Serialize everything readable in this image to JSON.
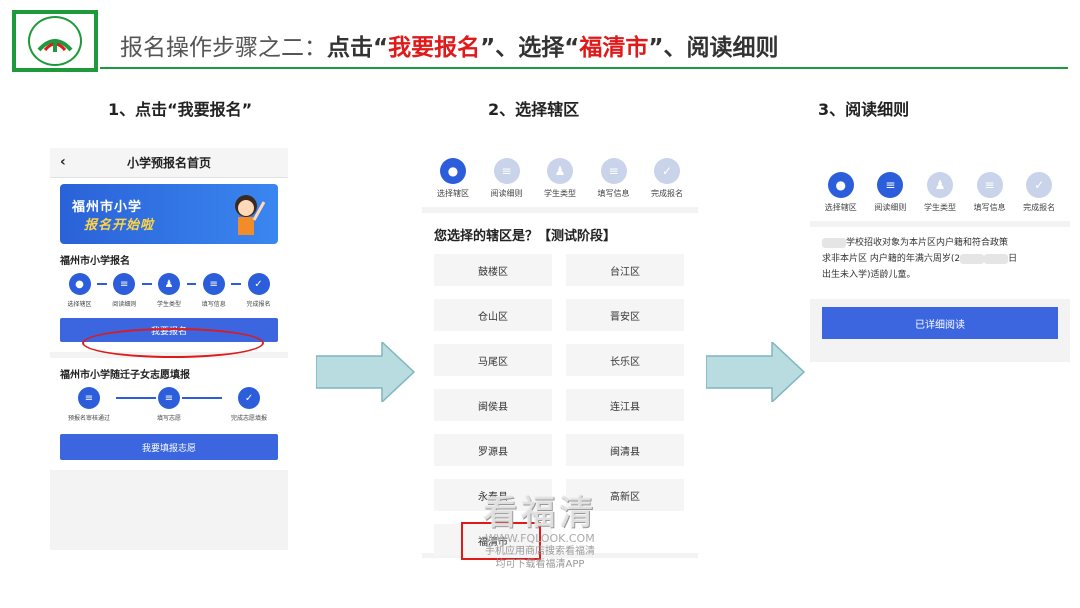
{
  "header": {
    "title_prefix": "报名操作步骤之二：",
    "title_click": "点击",
    "title_q1": "“",
    "title_hl1": "我要报名",
    "title_q2": "”",
    "title_sep1": "、选择",
    "title_q3": "“",
    "title_hl2": "福清市",
    "title_q4": "”",
    "title_sep2": "、阅读细则",
    "accent_color": "#e0191a",
    "brand_color": "#1e9a3c"
  },
  "steps": {
    "s1": "1、点击“我要报名”",
    "s2": "2、选择辖区",
    "s3": "3、阅读细则"
  },
  "phone1": {
    "header_title": "小学预报名首页",
    "back_icon": "chevron-left-icon",
    "banner_line1": "福州市小学",
    "banner_line2": "报名开始啦",
    "section1_title": "福州市小学报名",
    "flow1": [
      "选择辖区",
      "阅读细则",
      "学生类型",
      "填写信息",
      "完成报名"
    ],
    "apply_button": "我要报名",
    "section2_title": "福州市小学随迁子女志愿填报",
    "flow2": [
      "预报名审核通过",
      "填写志愿",
      "完成志愿填报"
    ],
    "volunteer_button": "我要填报志愿"
  },
  "phone2": {
    "steps": [
      "选择辖区",
      "阅读细则",
      "学生类型",
      "填写信息",
      "完成报名"
    ],
    "question": "您选择的辖区是？【测试阶段】",
    "districts": [
      "鼓楼区",
      "台江区",
      "仓山区",
      "晋安区",
      "马尾区",
      "长乐区",
      "闽侯县",
      "连江县",
      "罗源县",
      "闽清县",
      "永泰县",
      "高新区",
      "福清市"
    ]
  },
  "phone3": {
    "steps": [
      "选择辖区",
      "阅读细则",
      "学生类型",
      "填写信息",
      "完成报名"
    ],
    "text_line1": "学校招收对象为本片区内户籍和符合政策",
    "text_line2": "求非本片区 内户籍的年满六周岁(2",
    "text_line2_end": "日",
    "text_line3": "出生未入学)适龄儿童。",
    "read_button": "已详细阅读"
  },
  "watermark": {
    "big": "看福清",
    "url": "WWW.FQLOOK.COM",
    "line1": "手机应用商店搜索看福清",
    "line2": "均可下载看福清APP"
  }
}
